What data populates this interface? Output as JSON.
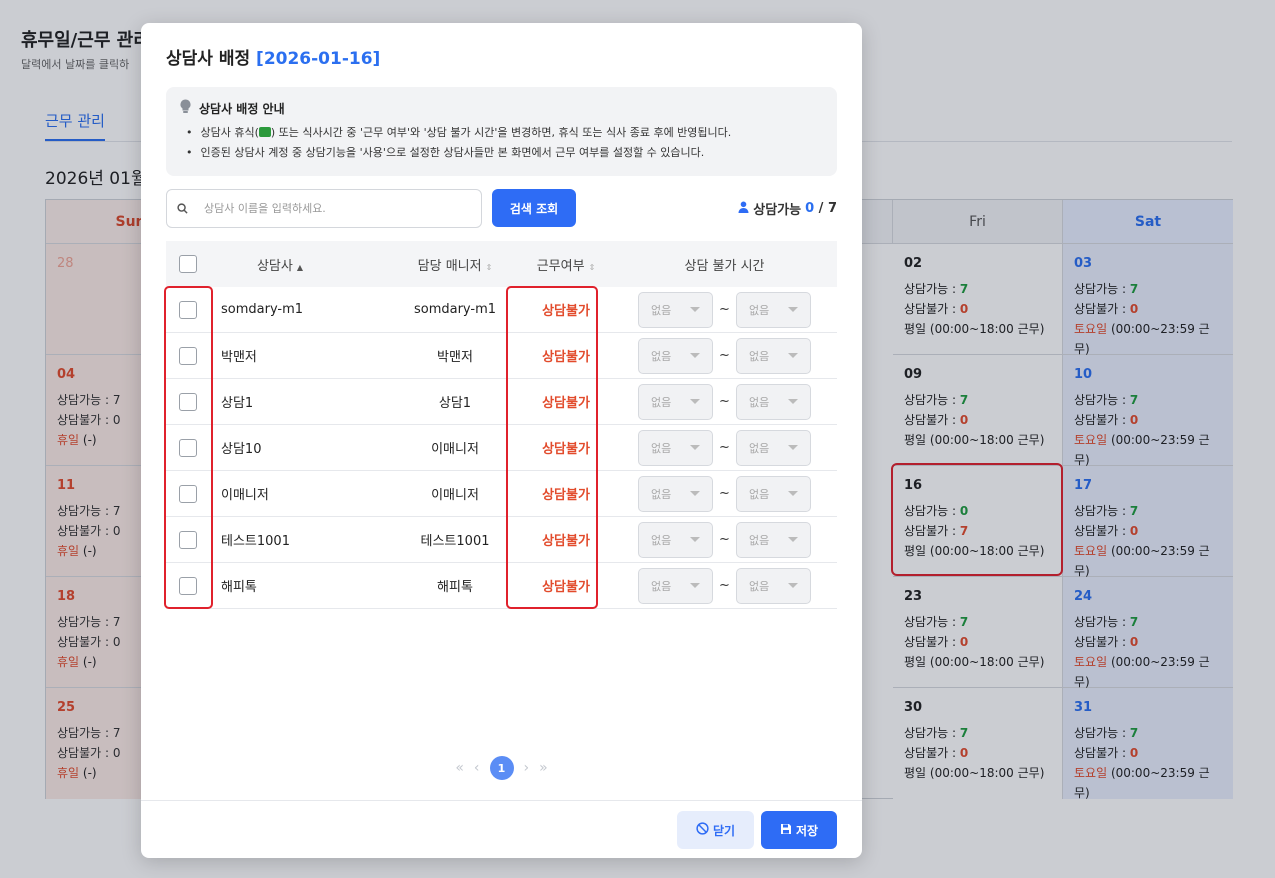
{
  "page": {
    "title": "휴무일/근무 관리",
    "subtitle": "달력에서 날짜를 클릭하",
    "tab": "근무 관리",
    "month": "2026년 01월"
  },
  "calendar": {
    "headers": {
      "sun": "Sun",
      "fri": "Fri",
      "sat": "Sat"
    },
    "sun": [
      {
        "day": "28"
      },
      {
        "day": "04",
        "avail": "상담가능 : 7",
        "unavail": "상담불가 : 0",
        "status_red": "휴일",
        "status_rest": " (-)"
      },
      {
        "day": "11",
        "avail": "상담가능 : 7",
        "unavail": "상담불가 : 0",
        "status_red": "휴일",
        "status_rest": " (-)"
      },
      {
        "day": "18",
        "avail": "상담가능 : 7",
        "unavail": "상담불가 : 0",
        "status_red": "휴일",
        "status_rest": " (-)"
      },
      {
        "day": "25",
        "avail": "상담가능 : 7",
        "unavail": "상담불가 : 0",
        "status_red": "휴일",
        "status_rest": " (-)"
      }
    ],
    "fri": [
      {
        "day": "02",
        "avail_label": "상담가능 : ",
        "avail_num": "7",
        "unavail_label": "상담불가 : ",
        "unavail_num": "0",
        "status": "평일 (00:00~18:00 근무)"
      },
      {
        "day": "09",
        "avail_label": "상담가능 : ",
        "avail_num": "7",
        "unavail_label": "상담불가 : ",
        "unavail_num": "0",
        "status": "평일 (00:00~18:00 근무)"
      },
      {
        "day": "16",
        "avail_label": "상담가능 : ",
        "avail_num": "0",
        "unavail_label": "상담불가 : ",
        "unavail_num": "7",
        "status": "평일 (00:00~18:00 근무)"
      },
      {
        "day": "23",
        "avail_label": "상담가능 : ",
        "avail_num": "7",
        "unavail_label": "상담불가 : ",
        "unavail_num": "0",
        "status": "평일 (00:00~18:00 근무)"
      },
      {
        "day": "30",
        "avail_label": "상담가능 : ",
        "avail_num": "7",
        "unavail_label": "상담불가 : ",
        "unavail_num": "0",
        "status": "평일 (00:00~18:00 근무)"
      }
    ],
    "sat": [
      {
        "day": "03",
        "avail_label": "상담가능 : ",
        "avail_num": "7",
        "unavail_label": "상담불가 : ",
        "unavail_num": "0",
        "status_red": "토요일",
        "status_rest": " (00:00~23:59 근무)"
      },
      {
        "day": "10",
        "avail_label": "상담가능 : ",
        "avail_num": "7",
        "unavail_label": "상담불가 : ",
        "unavail_num": "0",
        "status_red": "토요일",
        "status_rest": " (00:00~23:59 근무)"
      },
      {
        "day": "17",
        "avail_label": "상담가능 : ",
        "avail_num": "7",
        "unavail_label": "상담불가 : ",
        "unavail_num": "0",
        "status_red": "토요일",
        "status_rest": " (00:00~23:59 근무)"
      },
      {
        "day": "24",
        "avail_label": "상담가능 : ",
        "avail_num": "7",
        "unavail_label": "상담불가 : ",
        "unavail_num": "0",
        "status_red": "토요일",
        "status_rest": " (00:00~23:59 근무)"
      },
      {
        "day": "31",
        "avail_label": "상담가능 : ",
        "avail_num": "7",
        "unavail_label": "상담불가 : ",
        "unavail_num": "0",
        "status_red": "토요일",
        "status_rest": " (00:00~23:59 근무)"
      }
    ]
  },
  "modal": {
    "title": "상담사 배정",
    "date": "[2026-01-16]",
    "info_title": "상담사 배정 안내",
    "info_1a": "상담사 휴식(",
    "info_1b": ") 또는 식사시간 중 '근무 여부'와 '상담 불가 시간'을 변경하면, 휴식 또는 식사 종료 후에 반영됩니다.",
    "info_2": "인증된 상담사 계정 중 상담기능을 '사용'으로 설정한 상담사들만 본 화면에서 근무 여부를 설정할 수 있습니다.",
    "search_placeholder": "상담사 이름을 입력하세요.",
    "search_button": "검색 조회",
    "avail_label": "상담가능",
    "avail_count": "0",
    "avail_total": " / 7",
    "columns": {
      "name": "상담사",
      "manager": "담당 매니저",
      "work": "근무여부",
      "time": "상담 불가 시간"
    },
    "rows": [
      {
        "name": "somdary-m1",
        "manager": "somdary-m1",
        "work": "상담불가",
        "from": "없음",
        "tilde": "~",
        "to": "없음"
      },
      {
        "name": "박맨저",
        "manager": "박맨저",
        "work": "상담불가",
        "from": "없음",
        "tilde": "~",
        "to": "없음"
      },
      {
        "name": "상담1",
        "manager": "상담1",
        "work": "상담불가",
        "from": "없음",
        "tilde": "~",
        "to": "없음"
      },
      {
        "name": "상담10",
        "manager": "이매니저",
        "work": "상담불가",
        "from": "없음",
        "tilde": "~",
        "to": "없음"
      },
      {
        "name": "이매니저",
        "manager": "이매니저",
        "work": "상담불가",
        "from": "없음",
        "tilde": "~",
        "to": "없음"
      },
      {
        "name": "테스트1001",
        "manager": "테스트1001",
        "work": "상담불가",
        "from": "없음",
        "tilde": "~",
        "to": "없음"
      },
      {
        "name": "해피톡",
        "manager": "해피톡",
        "work": "상담불가",
        "from": "없음",
        "tilde": "~",
        "to": "없음"
      }
    ],
    "pager": {
      "first": "«",
      "prev": "‹",
      "current": "1",
      "next": "›",
      "last": "»"
    },
    "close_button": "닫기",
    "save_button": "저장"
  },
  "icons": {
    "search": "search-icon",
    "bulb": "lightbulb-icon",
    "user": "user-icon",
    "ban": "ban-icon",
    "save": "floppy-disk-icon"
  },
  "colors": {
    "accent": "#2e6cf5",
    "danger": "#e24b2c",
    "success": "#1e9b3e"
  }
}
